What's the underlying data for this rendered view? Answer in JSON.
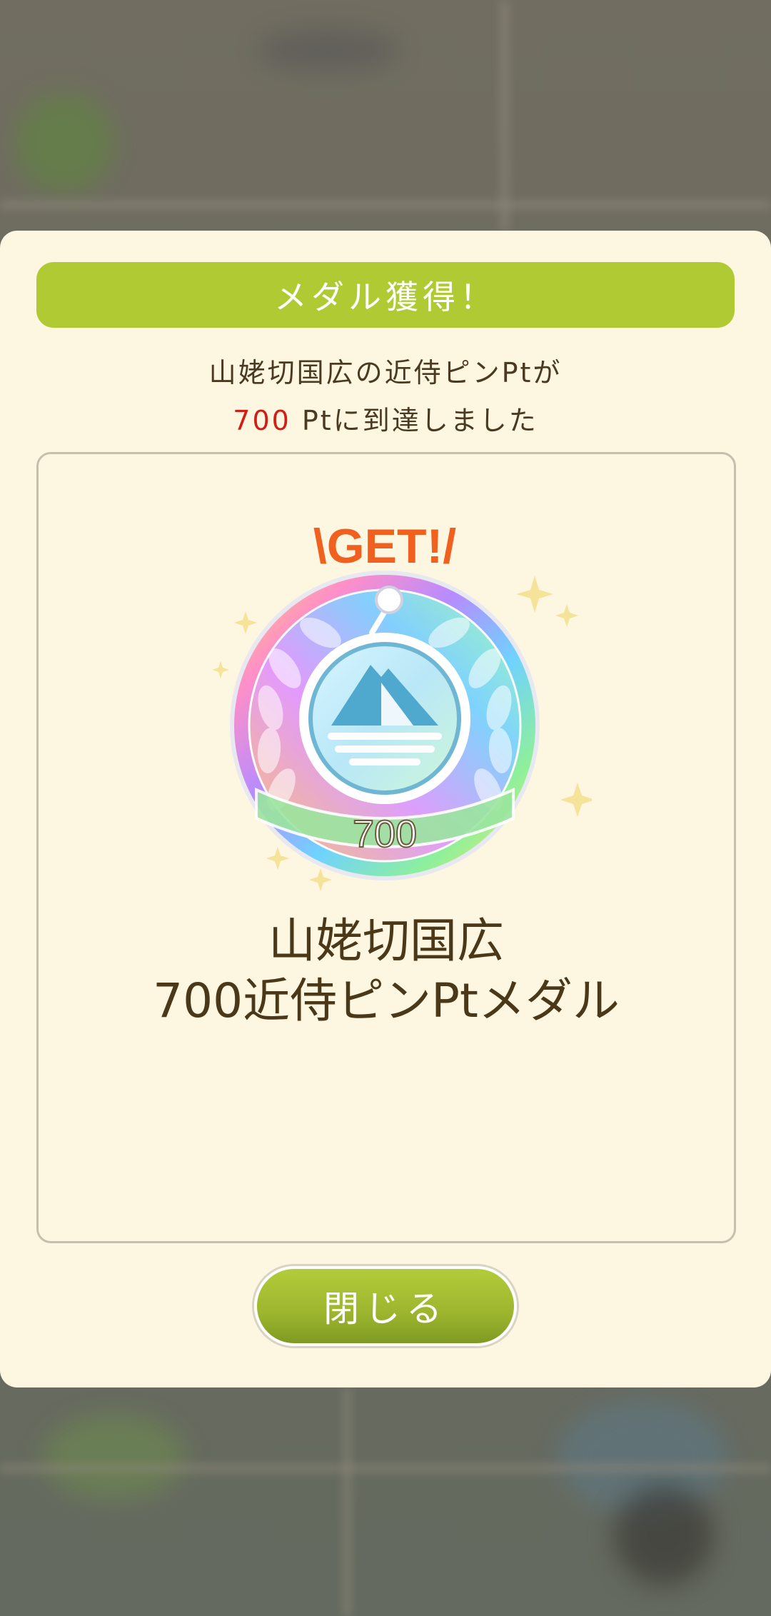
{
  "dialog": {
    "header": "メダル獲得！",
    "message_line1": "山姥切国広の近侍ピンPtが",
    "message_points": "700",
    "message_line2_rest": " Ptに到達しました",
    "medal": {
      "get_label": "\\GET!/",
      "number": "700",
      "title_line1": "山姥切国広",
      "title_line2": "700近侍ピンPtメダル"
    },
    "close_label": "閉じる"
  },
  "colors": {
    "header_green": "#b0ca34",
    "highlight_red": "#d11d13",
    "panel_bg": "#fdf6e1",
    "get_orange": "#f0601e"
  },
  "icons": {
    "medal": "rainbow-medal-icon",
    "mountain": "mountain-icon",
    "pin": "pin-icon",
    "sparkle": "sparkle-icon"
  }
}
